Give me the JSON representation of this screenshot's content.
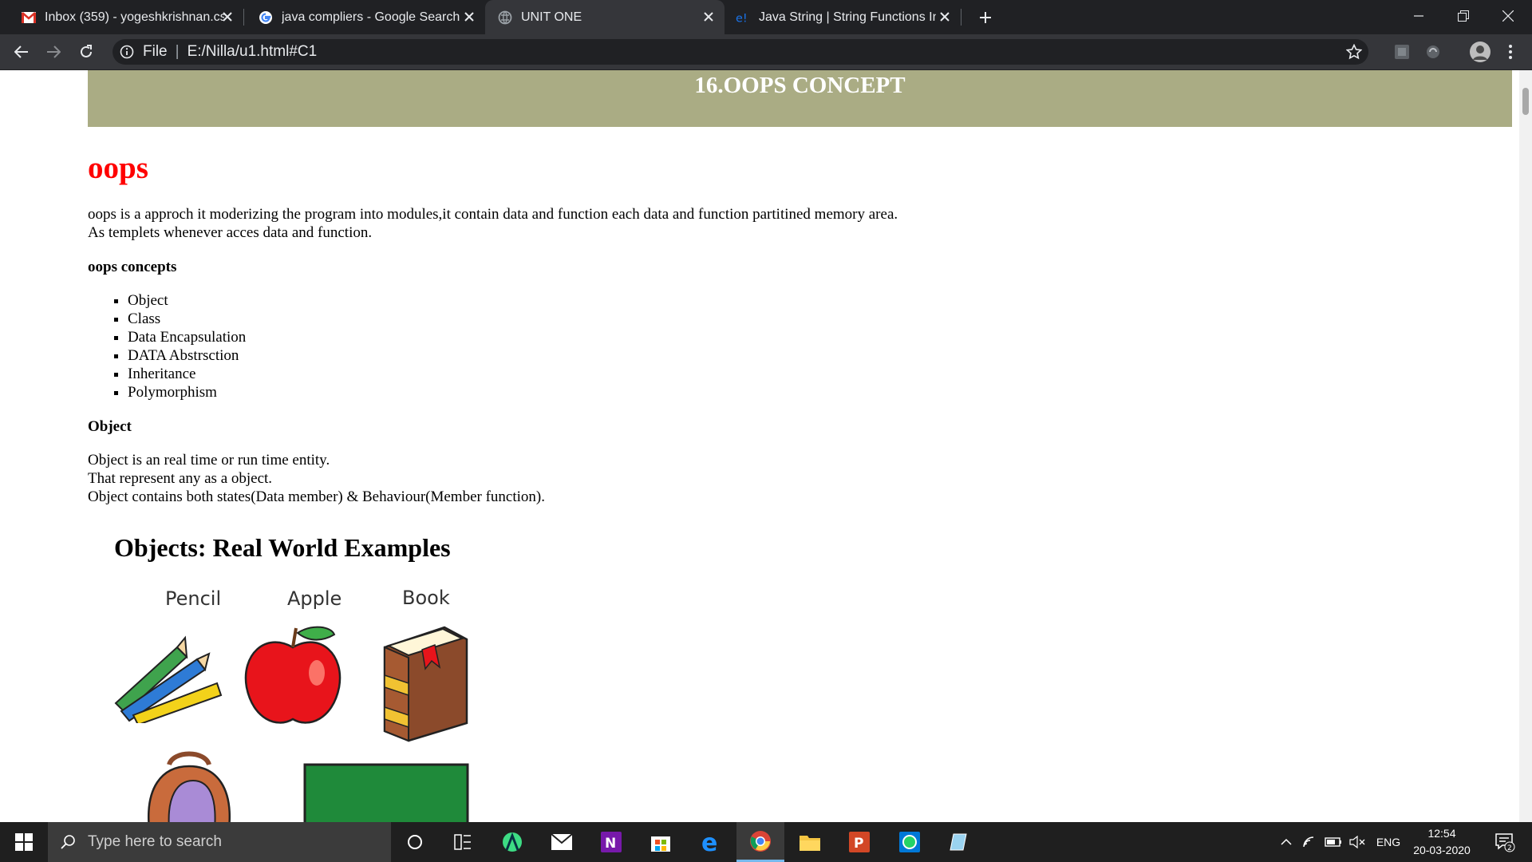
{
  "browser": {
    "tabs": [
      {
        "title": "Inbox (359) - yogeshkrishnan.cse",
        "icon": "gmail-icon",
        "active": false
      },
      {
        "title": "java compliers - Google Search",
        "icon": "google-icon",
        "active": false
      },
      {
        "title": "UNIT ONE",
        "icon": "globe-icon",
        "active": true
      },
      {
        "title": "Java String | String Functions In Ja",
        "icon": "edureka-icon",
        "active": false
      }
    ],
    "address": {
      "scheme_label": "File",
      "separator": "|",
      "url": "E:/Nilla/u1.html#C1"
    }
  },
  "page": {
    "banner_title": "16.OOPS CONCEPT",
    "heading": "oops",
    "intro_lines": [
      "oops is a approch it moderizing the program into modules,it contain data and function each data and function partitined memory area.",
      "As templets whenever acces data and function."
    ],
    "concepts_heading": "oops concepts",
    "concepts": [
      "Object",
      "Class",
      "Data Encapsulation",
      "DATA Abstrsction",
      "Inheritance",
      "Polymorphism"
    ],
    "object_heading": "Object",
    "object_lines": [
      "Object is an real time or run time entity.",
      "That represent any as a object.",
      "Object contains both states(Data member) & Behaviour(Member function)."
    ],
    "figure": {
      "title": "Objects: Real World Examples",
      "labels": [
        "Pencil",
        "Apple",
        "Book"
      ]
    }
  },
  "taskbar": {
    "search_placeholder": "Type here to search",
    "language": "ENG",
    "time": "12:54",
    "date": "20-03-2020",
    "notification_count": "2"
  },
  "colors": {
    "banner_bg": "#aaac84",
    "heading_red": "#ff0000",
    "tabstrip_bg": "#202124",
    "toolbar_bg": "#35363a"
  }
}
